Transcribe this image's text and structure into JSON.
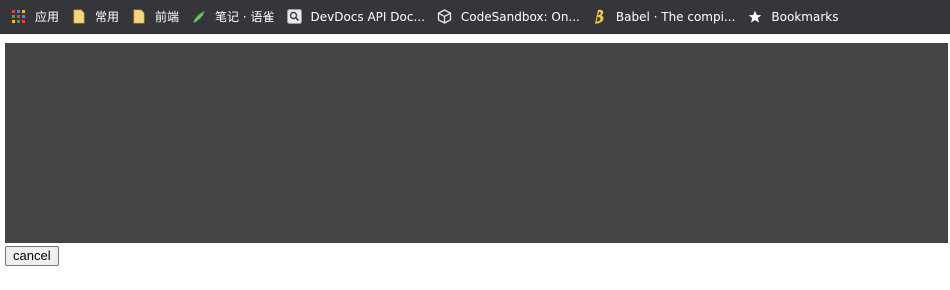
{
  "bookmarks_bar": {
    "items": [
      {
        "label": "应用",
        "icon": "apps-grid-icon"
      },
      {
        "label": "常用",
        "icon": "folder-icon"
      },
      {
        "label": "前端",
        "icon": "folder-icon"
      },
      {
        "label": "笔记 · 语雀",
        "icon": "yuque-bird-icon"
      },
      {
        "label": "DevDocs API Doc...",
        "icon": "devdocs-search-icon"
      },
      {
        "label": "CodeSandbox: On...",
        "icon": "codesandbox-cube-icon"
      },
      {
        "label": "Babel · The compi...",
        "icon": "babel-b-icon"
      },
      {
        "label": "Bookmarks",
        "icon": "star-icon"
      }
    ]
  },
  "content": {
    "cancel_label": "cancel"
  },
  "colors": {
    "bar_background": "#35363a",
    "content_panel": "#444444",
    "folder_yellow": "#f6d67a",
    "yuque_green": "#4caf50",
    "babel_yellow": "#f5c242"
  }
}
